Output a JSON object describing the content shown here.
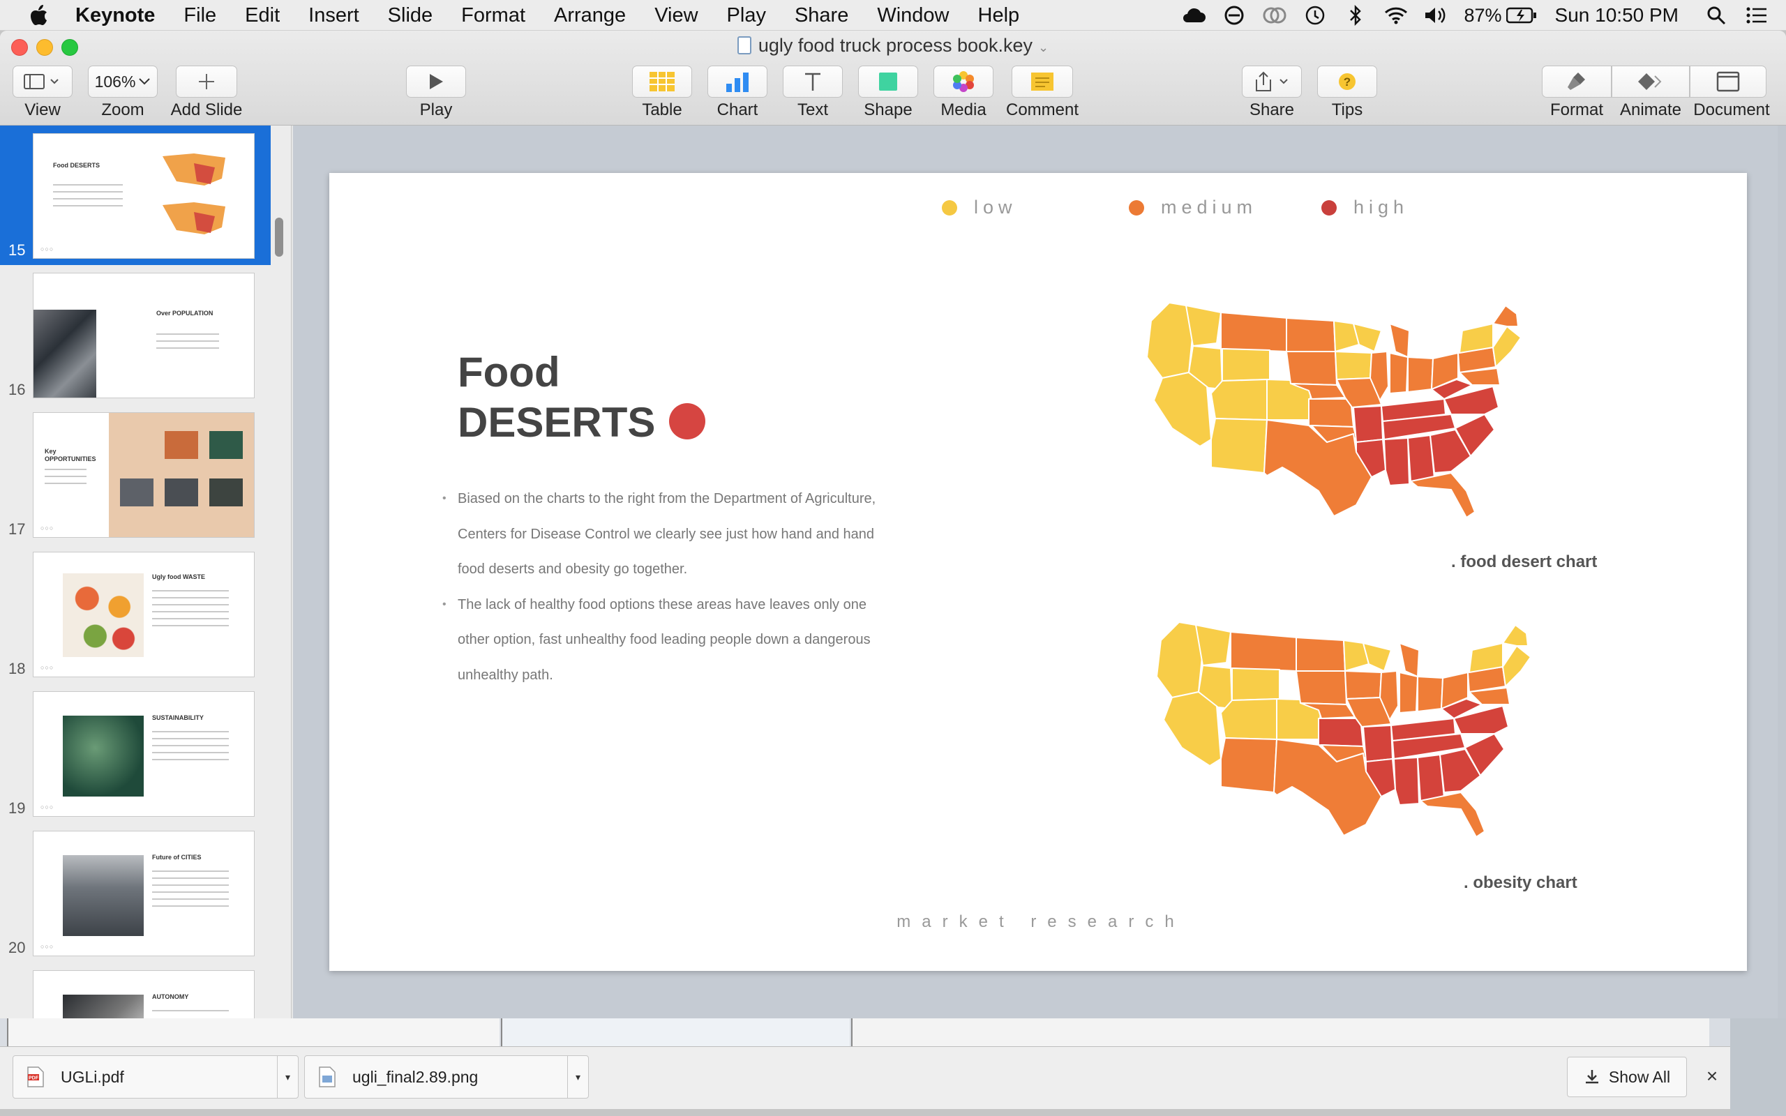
{
  "menubar": {
    "items": [
      "Keynote",
      "File",
      "Edit",
      "Insert",
      "Slide",
      "Format",
      "Arrange",
      "View",
      "Play",
      "Share",
      "Window",
      "Help"
    ],
    "battery": "87%",
    "clock": "Sun 10:50 PM"
  },
  "window": {
    "title": "ugly food truck process book.key"
  },
  "toolbar": {
    "view_label": "View",
    "zoom_value": "106%",
    "zoom_label": "Zoom",
    "add_slide_label": "Add Slide",
    "play_label": "Play",
    "table_label": "Table",
    "chart_label": "Chart",
    "text_label": "Text",
    "shape_label": "Shape",
    "media_label": "Media",
    "comment_label": "Comment",
    "share_label": "Share",
    "tips_label": "Tips",
    "format_label": "Format",
    "animate_label": "Animate",
    "document_label": "Document"
  },
  "navigator": {
    "slides": [
      {
        "number": "15",
        "title": "Food DESERTS",
        "selected": true
      },
      {
        "number": "16",
        "title": "Over POPULATION",
        "selected": false
      },
      {
        "number": "17",
        "title": "Key OPPORTUNITIES",
        "selected": false
      },
      {
        "number": "18",
        "title": "Ugly food WASTE",
        "selected": false
      },
      {
        "number": "19",
        "title": "SUSTAINABILITY",
        "selected": false
      },
      {
        "number": "20",
        "title": "Future of CITIES",
        "selected": false
      },
      {
        "number": "",
        "title": "AUTONOMY",
        "selected": false
      }
    ]
  },
  "slide": {
    "legend": [
      {
        "label": "low",
        "color": "#f5c842"
      },
      {
        "label": "medium",
        "color": "#ec7a34"
      },
      {
        "label": "high",
        "color": "#c9403c"
      }
    ],
    "title_line1": "Food",
    "title_line2": "DESERTS",
    "bullets": [
      "Biased on the charts to the right from the Department of Agriculture, Centers for Disease Control we clearly see just how hand and hand food deserts and obesity go together.",
      "The lack of healthy food options these areas have leaves only one other option, fast unhealthy food leading people down a dangerous unhealthy path."
    ],
    "map1_caption": ". food desert chart",
    "map2_caption": ". obesity chart",
    "footer": "market research"
  },
  "downloads": {
    "items": [
      {
        "name": "UGLi.pdf",
        "icon": "pdf-icon"
      },
      {
        "name": "ugli_final2.89.png",
        "icon": "image-file-icon"
      }
    ],
    "show_all_label": "Show All"
  },
  "colors": {
    "low": "#f5c842",
    "medium": "#ec7a34",
    "high": "#c9403c",
    "selection": "#1a6fd8"
  }
}
